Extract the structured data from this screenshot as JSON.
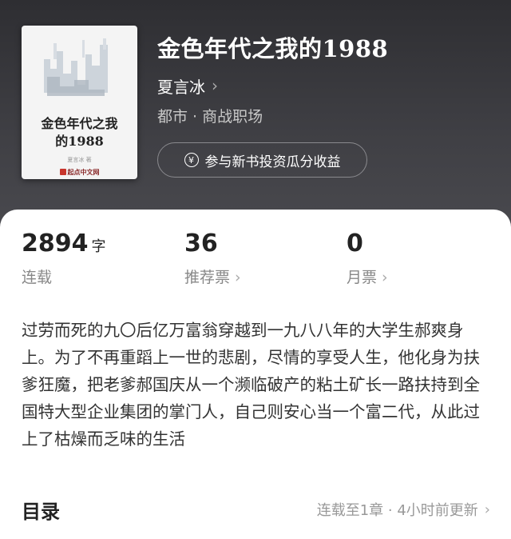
{
  "book": {
    "title": "金色年代之我的1988",
    "author": "夏言冰",
    "genre": "都市 · 商战职场",
    "invest_button": "参与新书投资瓜分收益",
    "cover": {
      "title": "金色年代之我\n的1988",
      "author": "夏言冰 著",
      "publisher": "起点中文网"
    }
  },
  "stats": [
    {
      "value": "2894",
      "unit": "字",
      "label": "连载"
    },
    {
      "value": "36",
      "unit": "",
      "label": "推荐票"
    },
    {
      "value": "0",
      "unit": "",
      "label": "月票"
    }
  ],
  "description": "过劳而死的九〇后亿万富翁穿越到一九八八年的大学生郝爽身上。为了不再重蹈上一世的悲剧，尽情的享受人生，他化身为扶爹狂魔，把老爹郝国庆从一个濒临破产的粘土矿长一路扶持到全国特大型企业集团的掌门人，自己则安心当一个富二代，从此过上了枯燥而乏味的生活",
  "toc": {
    "title": "目录",
    "status": "连载至1章 · 4小时前更新"
  },
  "icons": {
    "chevron": "chevron-right-icon",
    "yen": "yen-icon"
  }
}
